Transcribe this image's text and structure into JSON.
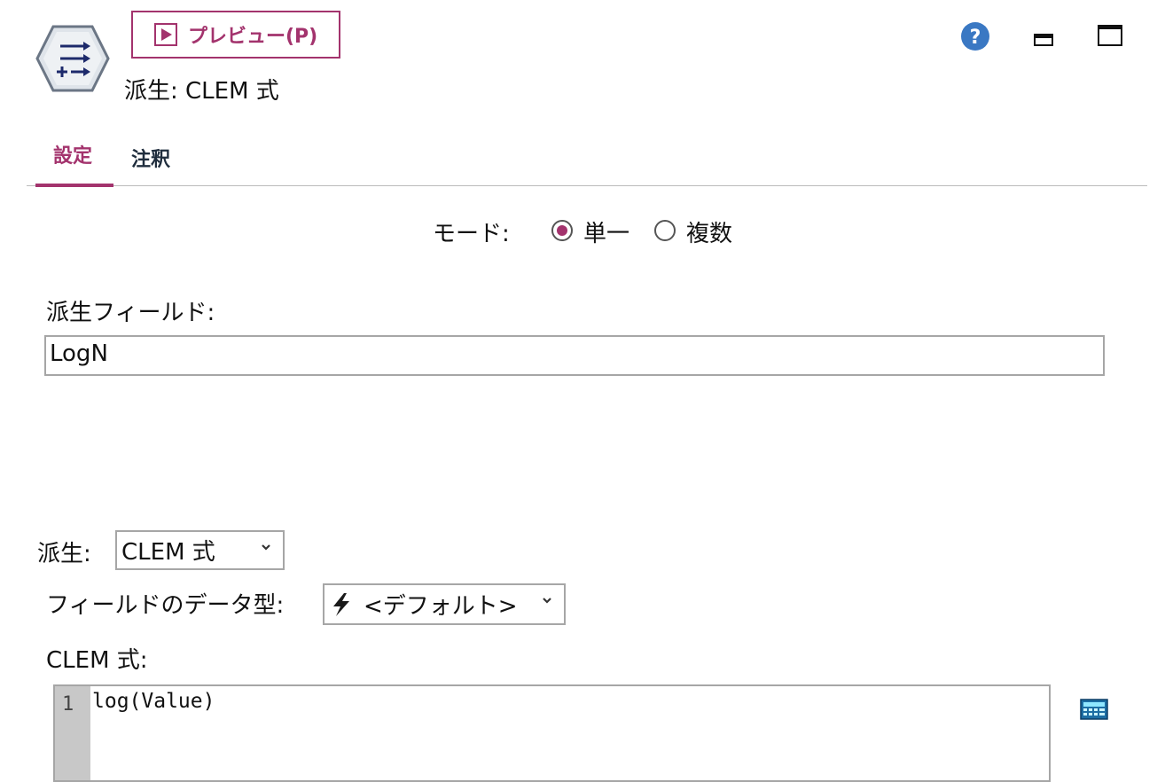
{
  "header": {
    "node_title": "派生: CLEM 式",
    "preview_label": "プレビュー(P)",
    "help_icon": "help-icon",
    "minimize_icon": "minimize-icon",
    "maximize_icon": "maximize-icon"
  },
  "tabs": [
    {
      "label": "設定",
      "active": true
    },
    {
      "label": "注釈",
      "active": false
    }
  ],
  "mode": {
    "label": "モード:",
    "options": [
      {
        "label": "単一",
        "selected": true
      },
      {
        "label": "複数",
        "selected": false
      }
    ]
  },
  "derive_field": {
    "label": "派生フィールド:",
    "value": "LogN"
  },
  "derive_as": {
    "label": "派生:",
    "value": "CLEM 式"
  },
  "field_type": {
    "label": "フィールドのデータ型:",
    "value": "<デフォルト>"
  },
  "clem": {
    "label": "CLEM 式:",
    "line_number": "1",
    "code": "log(Value)"
  },
  "colors": {
    "accent": "#a3336d",
    "help_blue": "#3a78c3",
    "border": "#a6a6a6"
  }
}
